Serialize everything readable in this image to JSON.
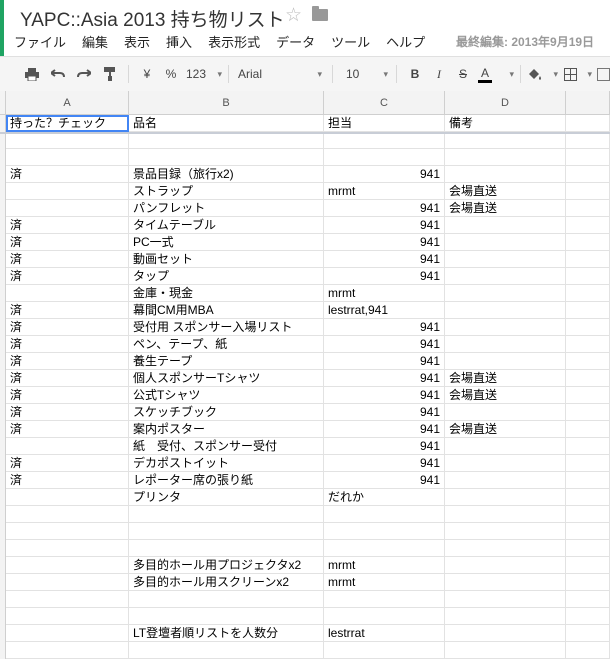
{
  "doc": {
    "title": "YAPC::Asia 2013 持ち物リスト",
    "last_edit": "最終編集: 2013年9月19日"
  },
  "menu": [
    "ファイル",
    "編集",
    "表示",
    "挿入",
    "表示形式",
    "データ",
    "ツール",
    "ヘルプ"
  ],
  "toolbar": {
    "currency": "¥",
    "percent": "%",
    "format": "123",
    "font": "Arial",
    "size": "10",
    "bold": "B",
    "italic": "I",
    "strike": "S",
    "textcolor": "A"
  },
  "columns": [
    "A",
    "B",
    "C",
    "D"
  ],
  "header_row": [
    "持った？チェック",
    "品名",
    "担当",
    "備考"
  ],
  "rows": [
    [
      "",
      "",
      "",
      ""
    ],
    [
      "",
      "",
      "",
      ""
    ],
    [
      "済",
      "景品目録（旅行x2)",
      "941",
      ""
    ],
    [
      "",
      "ストラップ",
      "mrmt",
      "会場直送"
    ],
    [
      "",
      "パンフレット",
      "941",
      "会場直送"
    ],
    [
      "済",
      "タイムテーブル",
      "941",
      ""
    ],
    [
      "済",
      "PC一式",
      "941",
      ""
    ],
    [
      "済",
      "動画セット",
      "941",
      ""
    ],
    [
      "済",
      "タップ",
      "941",
      ""
    ],
    [
      "",
      "金庫・現金",
      "mrmt",
      ""
    ],
    [
      "済",
      "幕間CM用MBA",
      "lestrrat,941",
      ""
    ],
    [
      "済",
      "受付用 スポンサー入場リスト",
      "941",
      ""
    ],
    [
      "済",
      "ペン、テープ、紙",
      "941",
      ""
    ],
    [
      "済",
      "養生テープ",
      "941",
      ""
    ],
    [
      "済",
      "個人スポンサーTシャツ",
      "941",
      "会場直送"
    ],
    [
      "済",
      "公式Tシャツ",
      "941",
      "会場直送"
    ],
    [
      "済",
      "スケッチブック",
      "941",
      ""
    ],
    [
      "済",
      "案内ポスター",
      "941",
      "会場直送"
    ],
    [
      "",
      "紙　受付、スポンサー受付",
      "941",
      ""
    ],
    [
      "済",
      "デカポストイット",
      "941",
      ""
    ],
    [
      "済",
      "レポーター席の張り紙",
      "941",
      ""
    ],
    [
      "",
      "プリンタ",
      "だれか",
      ""
    ],
    [
      "",
      "",
      "",
      ""
    ],
    [
      "",
      "",
      "",
      ""
    ],
    [
      "",
      "",
      "",
      ""
    ],
    [
      "",
      "多目的ホール用プロジェクタx2",
      "mrmt",
      ""
    ],
    [
      "",
      "多目的ホール用スクリーンx2",
      "mrmt",
      ""
    ],
    [
      "",
      "",
      "",
      ""
    ],
    [
      "",
      "",
      "",
      ""
    ],
    [
      "",
      "LT登壇者順リストを人数分",
      "lestrrat",
      ""
    ],
    [
      "",
      "",
      "",
      ""
    ]
  ]
}
